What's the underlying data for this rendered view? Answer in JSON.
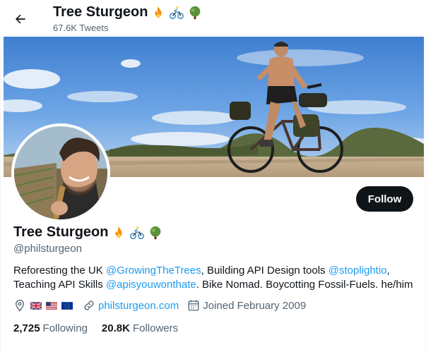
{
  "header": {
    "title": "Tree Sturgeon",
    "tweet_count": "67.6K Tweets"
  },
  "profile": {
    "display_name": "Tree Sturgeon",
    "name_emojis": [
      "fire-emoji",
      "cyclist-emoji",
      "tree-emoji"
    ],
    "handle": "@philsturgeon",
    "follow_label": "Follow",
    "bio": {
      "line1_a": "Reforesting the UK ",
      "mention1": "@GrowingTheTrees",
      "line1_b": ", Building API Design tools ",
      "mention2": "@stoplightio",
      "line1_c": ",",
      "line2_a": "Teaching API Skills ",
      "mention3": "@apisyouwonthate",
      "line2_b": ". Bike Nomad. Boycotting Fossil-Fuels. he/him"
    },
    "location_flags": [
      "uk-flag",
      "us-flag",
      "eu-flag"
    ],
    "website": "philsturgeon.com",
    "joined": "Joined February 2009",
    "following_count": "2,725",
    "following_label": "Following",
    "followers_count": "20.8K",
    "followers_label": "Followers"
  },
  "colors": {
    "link": "#1d9bf0",
    "secondary_text": "#536471",
    "button_bg": "#0f1419"
  },
  "icons": {
    "back": "arrow-left-icon",
    "location": "location-pin-icon",
    "website": "link-icon",
    "joined": "calendar-icon"
  }
}
